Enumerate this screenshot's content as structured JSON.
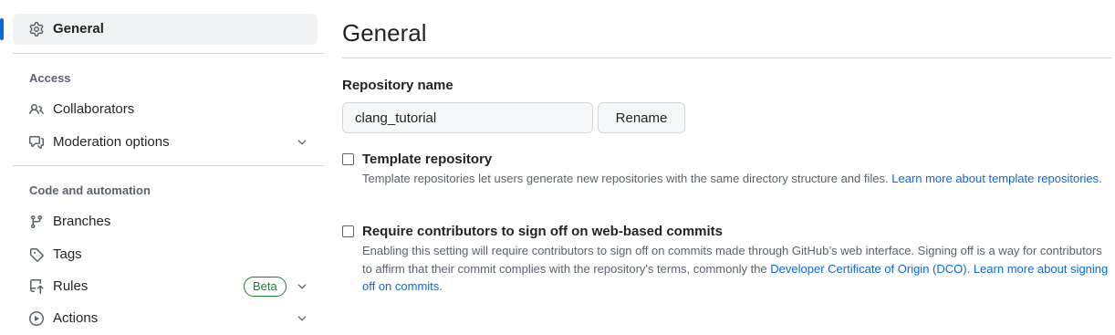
{
  "sidebar": {
    "general": {
      "label": "General",
      "icon": "gear-icon"
    },
    "sections": {
      "access": "Access",
      "code_automation": "Code and automation"
    },
    "items": [
      {
        "label": "Collaborators",
        "icon": "people-icon",
        "expandable": false
      },
      {
        "label": "Moderation options",
        "icon": "comment-discussion-icon",
        "expandable": true
      },
      {
        "label": "Branches",
        "icon": "git-branch-icon",
        "expandable": false
      },
      {
        "label": "Tags",
        "icon": "tag-icon",
        "expandable": false
      },
      {
        "label": "Rules",
        "icon": "repo-push-icon",
        "expandable": true,
        "badge": "Beta"
      },
      {
        "label": "Actions",
        "icon": "play-icon",
        "expandable": true
      }
    ],
    "accent_color": "#0969da",
    "badge_color": "#1a7f37"
  },
  "main": {
    "title": "General",
    "repo_name": {
      "label": "Repository name",
      "value": "clang_tutorial",
      "button": "Rename"
    },
    "template": {
      "title": "Template repository",
      "checked": false,
      "desc": "Template repositories let users generate new repositories with the same directory structure and files.",
      "link": "Learn more about template repositories."
    },
    "signoff": {
      "title": "Require contributors to sign off on web-based commits",
      "checked": false,
      "desc1": "Enabling this setting will require contributors to sign off on commits made through GitHub’s web interface. Signing off is a way for contributors to affirm that their commit complies with the repository's terms, commonly the",
      "link1": "Developer Certificate of Origin (DCO).",
      "link2": "Learn more about signing off on commits."
    }
  }
}
